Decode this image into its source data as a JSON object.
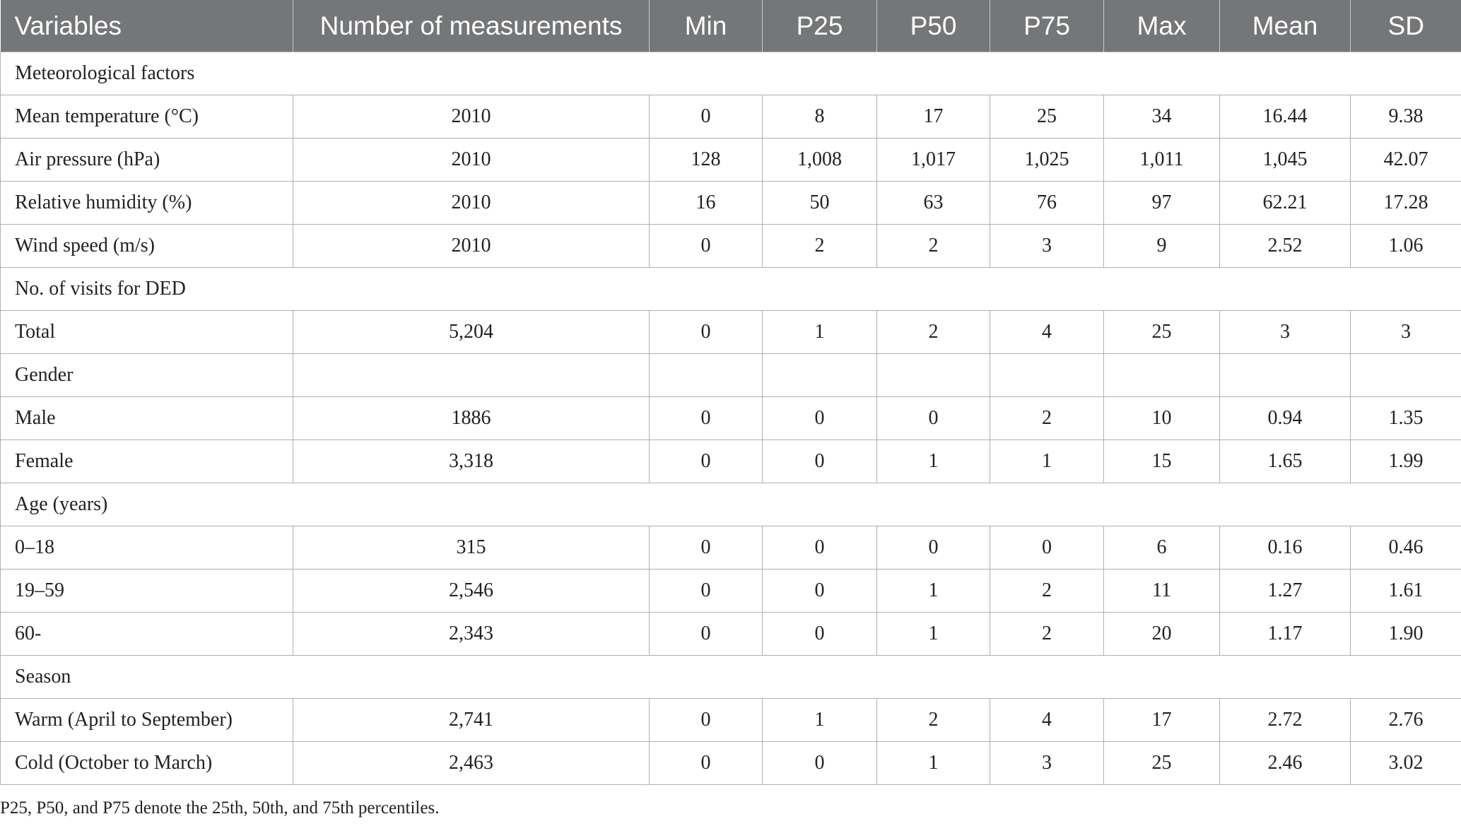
{
  "table": {
    "headers": [
      "Variables",
      "Number of measurements",
      "Min",
      "P25",
      "P50",
      "P75",
      "Max",
      "Mean",
      "SD"
    ],
    "rows": [
      {
        "type": "section",
        "label": "Meteorological factors"
      },
      {
        "type": "data",
        "cells": [
          "Mean temperature (°C)",
          "2010",
          "0",
          "8",
          "17",
          "25",
          "34",
          "16.44",
          "9.38"
        ]
      },
      {
        "type": "data",
        "cells": [
          "Air pressure (hPa)",
          "2010",
          "128",
          "1,008",
          "1,017",
          "1,025",
          "1,011",
          "1,045",
          "42.07"
        ]
      },
      {
        "type": "data",
        "cells": [
          "Relative humidity (%)",
          "2010",
          "16",
          "50",
          "63",
          "76",
          "97",
          "62.21",
          "17.28"
        ]
      },
      {
        "type": "data",
        "cells": [
          "Wind speed (m/s)",
          "2010",
          "0",
          "2",
          "2",
          "3",
          "9",
          "2.52",
          "1.06"
        ]
      },
      {
        "type": "section",
        "label": "No. of visits for DED"
      },
      {
        "type": "data",
        "cells": [
          "Total",
          "5,204",
          "0",
          "1",
          "2",
          "4",
          "25",
          "3",
          "3"
        ]
      },
      {
        "type": "data",
        "cells": [
          "Gender",
          "",
          "",
          "",
          "",
          "",
          "",
          "",
          ""
        ]
      },
      {
        "type": "data",
        "cells": [
          "Male",
          "1886",
          "0",
          "0",
          "0",
          "2",
          "10",
          "0.94",
          "1.35"
        ]
      },
      {
        "type": "data",
        "cells": [
          "Female",
          "3,318",
          "0",
          "0",
          "1",
          "1",
          "15",
          "1.65",
          "1.99"
        ]
      },
      {
        "type": "section",
        "label": "Age (years)"
      },
      {
        "type": "data",
        "cells": [
          "0–18",
          "315",
          "0",
          "0",
          "0",
          "0",
          "6",
          "0.16",
          "0.46"
        ]
      },
      {
        "type": "data",
        "cells": [
          "19–59",
          "2,546",
          "0",
          "0",
          "1",
          "2",
          "11",
          "1.27",
          "1.61"
        ]
      },
      {
        "type": "data",
        "cells": [
          "60-",
          "2,343",
          "0",
          "0",
          "1",
          "2",
          "20",
          "1.17",
          "1.90"
        ]
      },
      {
        "type": "section",
        "label": "Season"
      },
      {
        "type": "data",
        "cells": [
          "Warm (April to September)",
          "2,741",
          "0",
          "1",
          "2",
          "4",
          "17",
          "2.72",
          "2.76"
        ]
      },
      {
        "type": "data",
        "cells": [
          "Cold (October to March)",
          "2,463",
          "0",
          "0",
          "1",
          "3",
          "25",
          "2.46",
          "3.02"
        ]
      }
    ]
  },
  "footnote": "P25, P50, and P75 denote the 25th, 50th, and 75th percentiles.",
  "colors": {
    "header_bg": "#747678",
    "header_text": "#ffffff",
    "border": "#b0b0b0"
  }
}
